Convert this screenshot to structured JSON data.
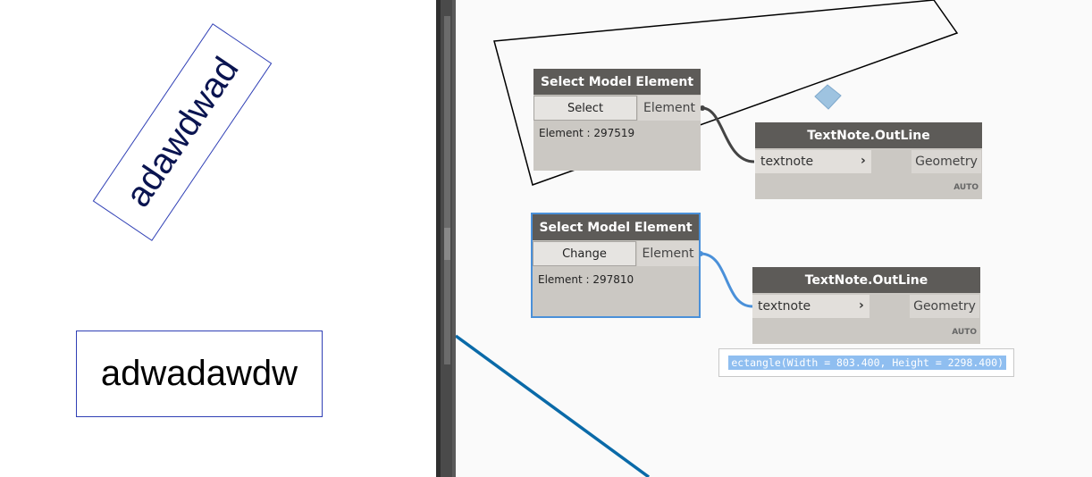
{
  "revit": {
    "rotated_note_text": "adawdwad",
    "flat_note_text": "adwadawdw"
  },
  "nodes": [
    {
      "title": "Select Model Element",
      "button_label": "Select",
      "output_port": "Element",
      "info": "Element : 297519",
      "selected": false
    },
    {
      "title": "Select Model Element",
      "button_label": "Change",
      "output_port": "Element",
      "info": "Element : 297810",
      "selected": true
    },
    {
      "title": "TextNote.OutLine",
      "input_port": "textnote",
      "output_port": "Geometry",
      "lacing": "AUTO"
    },
    {
      "title": "TextNote.OutLine",
      "input_port": "textnote",
      "output_port": "Geometry",
      "lacing": "AUTO"
    }
  ],
  "preview": {
    "text": "ectangle(Width = 803.400, Height = 2298.400)"
  },
  "colors": {
    "node_header": "#5d5b58",
    "node_body": "#cbc8c3",
    "wire_default": "#444444",
    "wire_selected": "#4a90d9",
    "background_line": "#0a6aa8"
  }
}
